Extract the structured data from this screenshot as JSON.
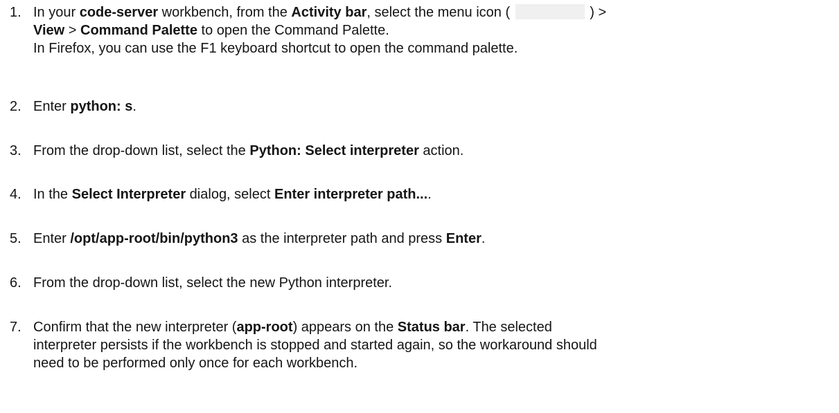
{
  "steps": [
    {
      "number": "1.",
      "lines": [
        {
          "t1": "In your ",
          "b1": "code-server",
          "t2": " workbench, from the  ",
          "b2": "Activity bar",
          "t3": ", select the menu icon ( ",
          "t4": " ) >"
        },
        {
          "b1": "View",
          "t1": " > ",
          "b2": "Command Palette",
          "t2": " to open the Command Palette."
        },
        {
          "t1": "In Firefox, you can use the F1 keyboard shortcut to open the command palette."
        }
      ]
    },
    {
      "number": "2.",
      "t1": "Enter ",
      "b1": "python: s",
      "t2": "."
    },
    {
      "number": "3.",
      "t1": "From the drop-down list, select the ",
      "b1": "Python: Select interpreter",
      "t2": " action."
    },
    {
      "number": "4.",
      "t1": "In the ",
      "b1": "Select Interpreter",
      "t2": " dialog, select ",
      "b2": "Enter interpreter path...",
      "t3": "."
    },
    {
      "number": "5.",
      "t1": "Enter ",
      "b1": "/opt/app-root/bin/python3",
      "t2": " as the interpreter path and press  ",
      "b2": "Enter",
      "t3": "."
    },
    {
      "number": "6.",
      "t1": "From the drop-down list, select the new Python interpreter."
    },
    {
      "number": "7.",
      "lines": [
        {
          "t1": "Confirm that the new interpreter (",
          "b1": "app-root",
          "t2": ") appears on the ",
          "b2": "Status bar",
          "t3": ". The selected"
        },
        {
          "t1": "interpreter persists if the workbench is stopped and started again, so the workaround should"
        },
        {
          "t1": "need to be performed only once for each workbench."
        }
      ]
    }
  ]
}
